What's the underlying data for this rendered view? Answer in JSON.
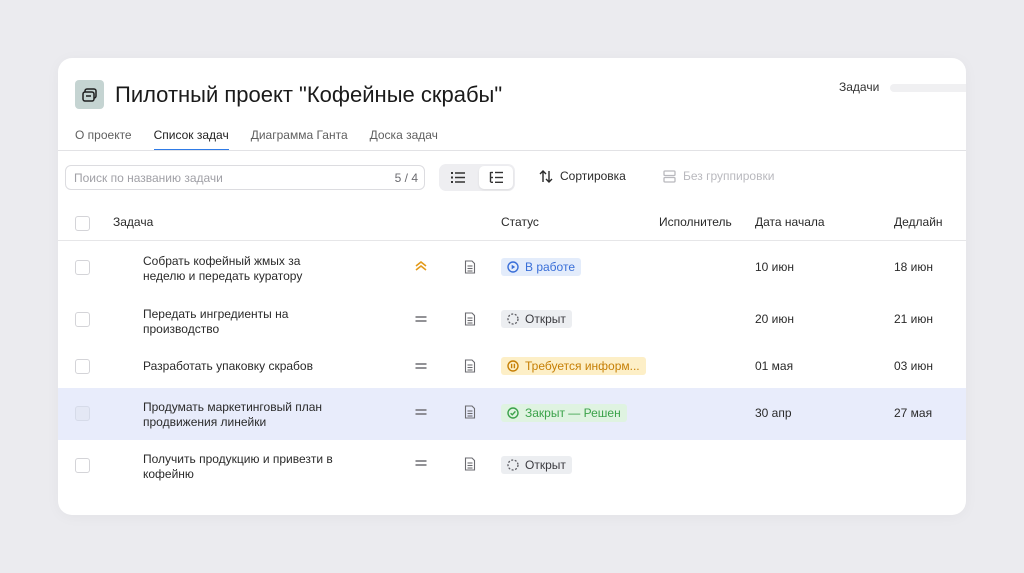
{
  "project": {
    "title": "Пилотный проект \"Кофейные скрабы\"",
    "icon": "project-icon",
    "tasks_link": "Задачи"
  },
  "tabs": [
    {
      "label": "О проекте",
      "active": false
    },
    {
      "label": "Список задач",
      "active": true
    },
    {
      "label": "Диаграмма Ганта",
      "active": false
    },
    {
      "label": "Доска задач",
      "active": false
    }
  ],
  "toolbar": {
    "search_placeholder": "Поиск по названию задачи",
    "search_count": "5 / 4",
    "sort_label": "Сортировка",
    "group_label": "Без группировки"
  },
  "table": {
    "headers": {
      "task": "Задача",
      "status": "Статус",
      "assignee": "Исполнитель",
      "start": "Дата начала",
      "deadline": "Дедлайн"
    },
    "rows": [
      {
        "name": "Собрать кофейный жмых за неделю и передать куратору",
        "priority": "high",
        "status": "В работе",
        "status_type": "inprogress",
        "start": "10 июн",
        "deadline": "18 июн"
      },
      {
        "name": "Передать ингредиенты на производство",
        "priority": "normal",
        "status": "Открыт",
        "status_type": "open",
        "start": "20 июн",
        "deadline": "21 июн"
      },
      {
        "name": "Разработать упаковку скрабов",
        "priority": "normal",
        "status": "Требуется информ...",
        "status_type": "needinfo",
        "start": "01 мая",
        "deadline": "03 июн"
      },
      {
        "name": "Продумать маркетинговый план продвижения линейки",
        "priority": "normal",
        "status": "Закрыт — Решен",
        "status_type": "closed",
        "start": "30 апр",
        "deadline": "27 мая"
      },
      {
        "name": "Получить продукцию и привезти в кофейню",
        "priority": "normal",
        "status": "Открыт",
        "status_type": "open",
        "start": "",
        "deadline": ""
      }
    ]
  },
  "colors": {
    "accent": "#2f7be6",
    "selected_row": "#e8ecfb",
    "status_inprogress_bg": "#e3ecfb",
    "status_inprogress_fg": "#3a6fd8",
    "status_open_bg": "#eceef1",
    "status_needinfo_bg": "#fdefc7",
    "status_needinfo_fg": "#c67f06",
    "status_closed_bg": "#dff3e1",
    "status_closed_fg": "#3ba24a",
    "priority_high": "#e39a1a"
  }
}
